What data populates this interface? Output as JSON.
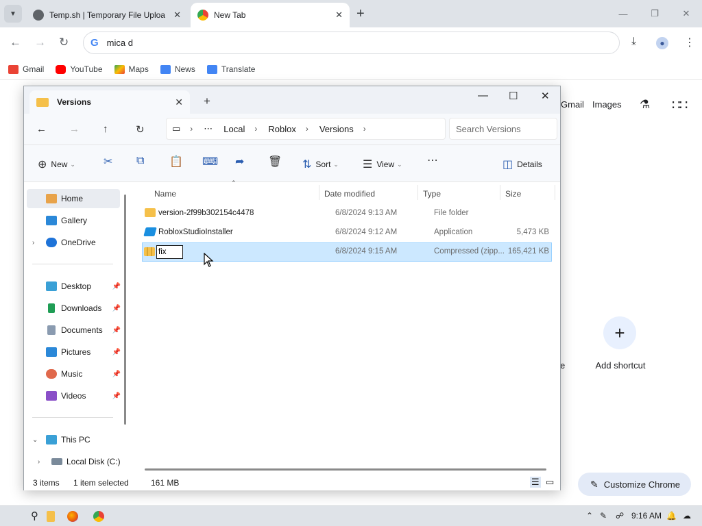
{
  "chrome": {
    "tabs": [
      {
        "label": "Temp.sh | Temporary File Uploa"
      },
      {
        "label": "New Tab"
      }
    ],
    "omnibox_value": "mica d",
    "bookmarks": [
      {
        "label": "Gmail",
        "icon": "gmail-icon",
        "color": "#ea4335"
      },
      {
        "label": "YouTube",
        "icon": "youtube-icon",
        "color": "#ff0000"
      },
      {
        "label": "Maps",
        "icon": "maps-icon",
        "color": "#34a853"
      },
      {
        "label": "News",
        "icon": "news-icon",
        "color": "#4285f4"
      },
      {
        "label": "Translate",
        "icon": "translate-icon",
        "color": "#4285f4"
      }
    ],
    "ntp": {
      "gmail_link": "Gmail",
      "images_link": "Images",
      "add_shortcut": "Add shortcut",
      "customize": "Customize Chrome",
      "partial_text": "e"
    }
  },
  "explorer": {
    "tab_title": "Versions",
    "breadcrumb": [
      "Local",
      "Roblox",
      "Versions"
    ],
    "search_placeholder": "Search Versions",
    "commands": {
      "new": "New",
      "sort": "Sort",
      "view": "View",
      "details": "Details"
    },
    "nav": {
      "home": "Home",
      "gallery": "Gallery",
      "onedrive": "OneDrive",
      "desktop": "Desktop",
      "downloads": "Downloads",
      "documents": "Documents",
      "pictures": "Pictures",
      "music": "Music",
      "videos": "Videos",
      "this_pc": "This PC",
      "local_disk": "Local Disk (C:)"
    },
    "columns": {
      "name": "Name",
      "date": "Date modified",
      "type": "Type",
      "size": "Size"
    },
    "rows": [
      {
        "name": "version-2f99b302154c4478",
        "date": "6/8/2024 9:13 AM",
        "type": "File folder",
        "size": ""
      },
      {
        "name": "RobloxStudioInstaller",
        "date": "6/8/2024 9:12 AM",
        "type": "Application",
        "size": "5,473 KB"
      },
      {
        "name": "fix",
        "date": "6/8/2024 9:15 AM",
        "type": "Compressed (zipp...",
        "size": "165,421 KB"
      }
    ],
    "status": {
      "items": "3 items",
      "selected": "1 item selected",
      "size": "161 MB"
    }
  },
  "taskbar": {
    "time": "9:16 AM"
  }
}
